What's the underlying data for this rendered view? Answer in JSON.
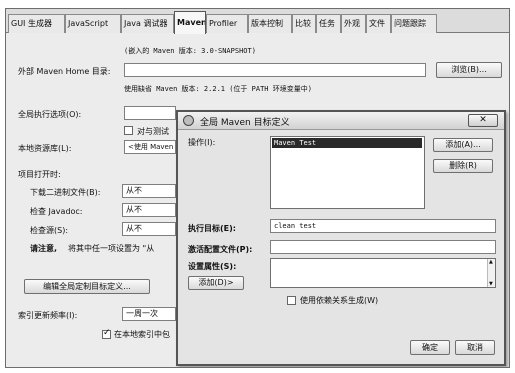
{
  "tabs": [
    {
      "label": "GUI 生成器"
    },
    {
      "label": "JavaScript"
    },
    {
      "label": "Java 调试器"
    },
    {
      "label": "Maven"
    },
    {
      "label": "Profiler"
    },
    {
      "label": "版本控制"
    },
    {
      "label": "比较"
    },
    {
      "label": "任务"
    },
    {
      "label": "外观"
    },
    {
      "label": "文件"
    },
    {
      "label": "问题跟踪"
    }
  ],
  "main": {
    "embedded_version": "(嵌入的 Maven 版本: 3.0-SNAPSHOT)",
    "home_label": "外部 Maven Home 目录:",
    "home_value": "",
    "browse_label": "浏览(B)...",
    "using_version": "使用缺省 Maven 版本: 2.2.1 (位于 PATH 环境变量中)",
    "global_opts_label": "全局执行选项(O):",
    "skip_tests_label": "对与测试",
    "local_repo_label": "本地资源库(L):",
    "local_repo_value": "<使用 Maven",
    "on_open_label": "项目打开时:",
    "download_binaries_label": "下载二进制文件(B):",
    "download_binaries_value": "从不",
    "javadoc_label": "检查 Javadoc:",
    "javadoc_value": "从不",
    "source_label": "检查源(S):",
    "source_value": "从不",
    "note_bold": "请注意,",
    "note_text": "将其中任一项设置为 \"从",
    "edit_goals_label": "编辑全局定制目标定义...",
    "index_freq_label": "索引更新频率(I):",
    "index_freq_value": "一周一次",
    "index_local_label": "在本地索引中包"
  },
  "dialog": {
    "title": "全局 Maven 目标定义",
    "close_glyph": "✕",
    "action_label": "操作(I):",
    "actions": [
      "Maven Test"
    ],
    "add_label": "添加(A)...",
    "remove_label": "删除(R)",
    "goals_label": "执行目标(E):",
    "goals_value": "clean test",
    "profiles_label": "激活配置文件(P):",
    "profiles_value": "",
    "props_label": "设置属性(S):",
    "props_add_label": "添加(D)>",
    "dependency_label": "使用依赖关系生成(W)",
    "ok_label": "确定",
    "cancel_label": "取消"
  }
}
